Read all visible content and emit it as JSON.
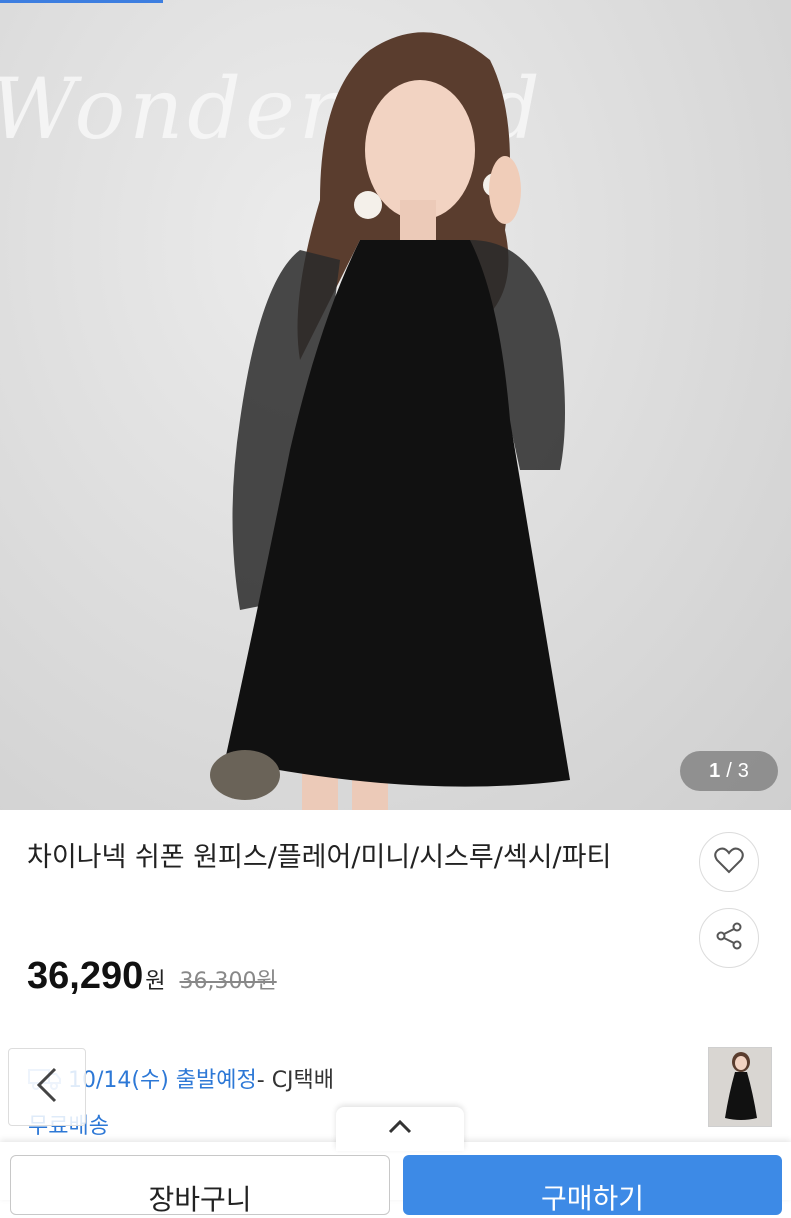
{
  "gallery": {
    "current": "1",
    "separator": "/",
    "total": "3"
  },
  "product": {
    "title": "차이나넥 쉬폰 원피스/플레어/미니/시스루/섹시/파티",
    "price": "36,290",
    "currency": "원",
    "original_price": "36,300원"
  },
  "shipping": {
    "date": "10/14(수) 출발예정",
    "carrier": " - CJ택배",
    "fee": "무료배송"
  },
  "actions": {
    "cart": "장바구니",
    "buy": "구매하기"
  },
  "colors": {
    "accent": "#3d8ae6",
    "link": "#2d78d6"
  },
  "icons": [
    "heart-icon",
    "share-icon",
    "truck-icon",
    "chevron-left-icon",
    "chevron-up-icon"
  ]
}
